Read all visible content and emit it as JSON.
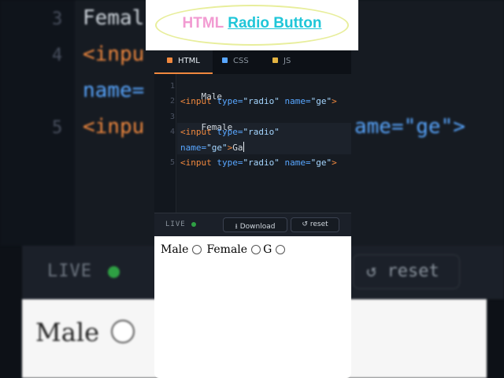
{
  "background": {
    "lines": [
      {
        "num": "3",
        "text": "Femal"
      },
      {
        "num": "4",
        "text": "<inpu"
      },
      {
        "num": "",
        "text": "name="
      },
      {
        "num": "5",
        "text": "<inpu",
        "tail": "ame=\"ge\">"
      }
    ],
    "live_label": "LIVE",
    "reset_label": "↺ reset",
    "preview_male": "Male"
  },
  "banner": {
    "html_word": "HTML",
    "rest": "Radio Button"
  },
  "tabs": [
    {
      "label": "HTML",
      "color": "#f0883e",
      "active": true
    },
    {
      "label": "CSS",
      "color": "#58a6ff",
      "active": false
    },
    {
      "label": "JS",
      "color": "#e3b341",
      "active": false
    }
  ],
  "editor": {
    "line_numbers": [
      "1",
      "2",
      "3",
      "4",
      "5"
    ],
    "line1": "Male",
    "line2": {
      "tag": "<input",
      "attr1": "type=",
      "val1": "\"radio\"",
      "attr2": "name=",
      "val2": "\"ge\"",
      "close": ">"
    },
    "line3": "Female",
    "line4a": {
      "tag": "<input",
      "attr1": "type=",
      "val1": "\"radio\""
    },
    "line4b": {
      "attr2": "name=",
      "val2": "\"ge\"",
      "close": ">",
      "text": "Ga"
    },
    "line5": {
      "tag": "<input",
      "attr1": "type=",
      "val1": "\"radio\"",
      "attr2": "name=",
      "val2": "\"ge\"",
      "close": ">"
    }
  },
  "livebar": {
    "live_label": "LIVE",
    "download_label": "Download",
    "reset_label": "reset"
  },
  "preview": {
    "label1": "Male",
    "label2": "Female",
    "label3": "G"
  }
}
